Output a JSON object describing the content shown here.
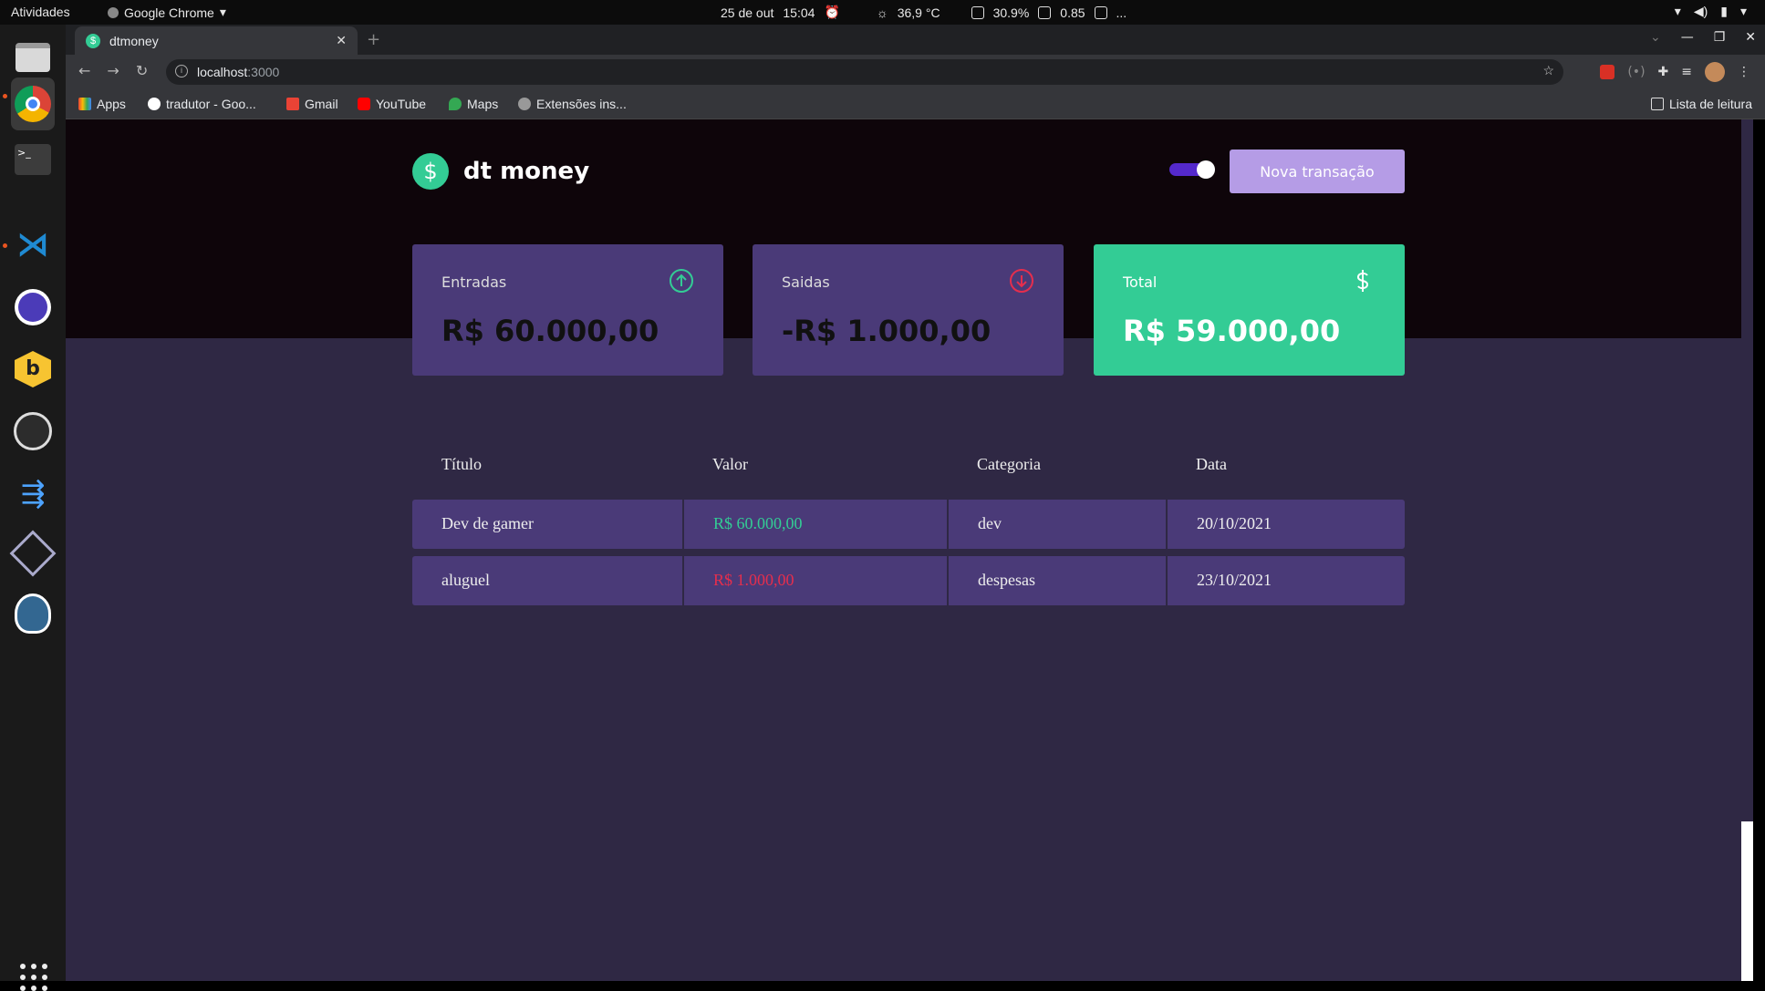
{
  "system": {
    "activities": "Atividades",
    "app_name": "Google Chrome",
    "date": "25 de out",
    "time": "15:04",
    "temp": "36,9 °C",
    "battery": "30.9%",
    "load": "0.85",
    "more": "..."
  },
  "browser": {
    "tab_title": "dtmoney",
    "url_host": "localhost",
    "url_port": ":3000",
    "bookmarks": [
      "Apps",
      "tradutor - Goo...",
      "Gmail",
      "YouTube",
      "Maps",
      "Extensões ins..."
    ],
    "reading_list": "Lista de leitura"
  },
  "app": {
    "logo_symbol": "$",
    "title": "dt money",
    "new_button": "Nova transação",
    "colors": {
      "green": "#33cc95",
      "red": "#e52e4d",
      "purple": "#5429cc",
      "card": "#4a3a78"
    }
  },
  "summary": {
    "income_label": "Entradas",
    "income_value": "R$ 60.000,00",
    "outcome_label": "Saidas",
    "outcome_value": "-R$ 1.000,00",
    "total_label": "Total",
    "total_value": "R$ 59.000,00"
  },
  "table": {
    "headers": [
      "Título",
      "Valor",
      "Categoria",
      "Data"
    ],
    "rows": [
      {
        "title": "Dev de gamer",
        "value": "R$ 60.000,00",
        "category": "dev",
        "date": "20/10/2021"
      },
      {
        "title": "aluguel",
        "value": "R$ 1.000,00",
        "category": "despesas",
        "date": "23/10/2021"
      }
    ]
  }
}
